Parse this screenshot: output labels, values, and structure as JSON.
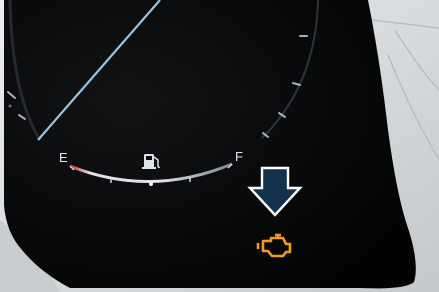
{
  "fuel_gauge": {
    "empty_label": "E",
    "full_label": "F",
    "level_fraction": 0.5
  },
  "icons": {
    "fuel_pump": "fuel-pump-icon",
    "engine_warning": "check-engine-icon",
    "pointer_arrow": "down-arrow-icon"
  },
  "colors": {
    "dashboard_black": "#050505",
    "warning_amber": "#f39a1c",
    "arrow_navy": "#14324e",
    "low_fuel_red": "#d4262b",
    "needle_blue": "#9bc4e2"
  }
}
